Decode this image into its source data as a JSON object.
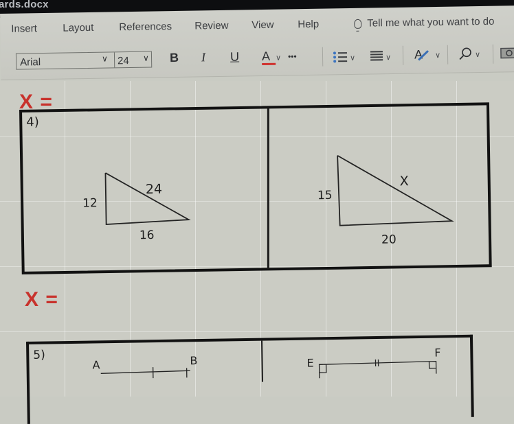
{
  "window": {
    "title_fragment": "ards.docx"
  },
  "ribbon": {
    "tabs": [
      "Insert",
      "Layout",
      "References",
      "Review",
      "View",
      "Help"
    ],
    "tell_me": "Tell me what you want to do",
    "font_name": "Arial",
    "font_size": "24",
    "bold_label": "B",
    "italic_label": "I",
    "underline_label": "U",
    "font_color_label": "A",
    "more_label": "•••",
    "font_color_hex": "#d0312d",
    "icons": [
      "bulb-icon",
      "bullets-icon",
      "align-icon",
      "styles-icon",
      "find-icon",
      "picture-icon"
    ]
  },
  "document": {
    "answer_label": "X =",
    "answer_color": "#c8322c",
    "problems": [
      {
        "number": "4)",
        "triangles": [
          {
            "vertical_side": "12",
            "hypotenuse": "24",
            "base": "16"
          },
          {
            "vertical_side": "15",
            "hypotenuse": "X",
            "base": "20"
          }
        ]
      },
      {
        "number": "5)",
        "segments": [
          {
            "left_point": "A",
            "right_point": "B"
          },
          {
            "left_point": "E",
            "right_point": "F",
            "mark": "||"
          }
        ]
      }
    ]
  }
}
